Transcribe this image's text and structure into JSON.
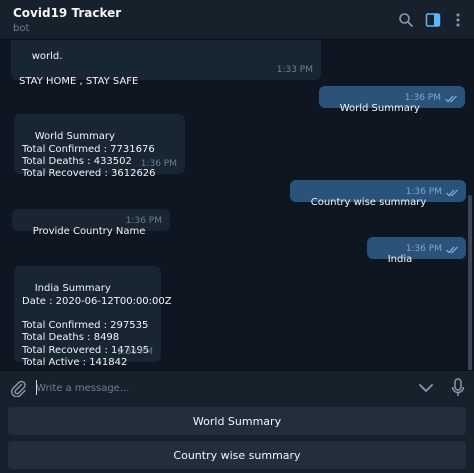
{
  "header": {
    "title": "Covid19 Tracker",
    "subtitle": "bot"
  },
  "messages": [
    {
      "direction": "in",
      "text": "world.\n\nSTAY HOME , STAY SAFE",
      "time": "1:33 PM"
    },
    {
      "direction": "out",
      "text": "World Summary",
      "time": "1:36 PM",
      "read": true
    },
    {
      "direction": "in",
      "text": "World Summary\nTotal Confirmed : 7731676\nTotal Deaths : 433502\nTotal Recovered : 3612626",
      "time": "1:36 PM"
    },
    {
      "direction": "out",
      "text": "Country wise summary",
      "time": "1:36 PM",
      "read": true
    },
    {
      "direction": "in",
      "text": "Provide Country Name",
      "time": "1:36 PM"
    },
    {
      "direction": "out",
      "text": "India",
      "time": "1:36 PM",
      "read": true
    },
    {
      "direction": "in",
      "text": "India Summary\nDate : 2020-06-12T00:00:00Z\n\nTotal Confirmed : 297535\nTotal Deaths : 8498\nTotal Recovered : 147195\nTotal Active : 141842",
      "time": "1:36 PM"
    }
  ],
  "composer": {
    "placeholder": "Write a message..."
  },
  "keyboard": {
    "buttons": [
      "World Summary",
      "Country wise summary"
    ]
  },
  "colors": {
    "background": "#0e1621",
    "panel": "#17212b",
    "incoming": "#182533",
    "outgoing": "#2b5278",
    "accent": "#5eb5f7"
  },
  "icons": {
    "header": [
      "search-icon",
      "sidebar-toggle-icon",
      "more-menu-icon"
    ],
    "composer": [
      "attach-icon",
      "chevron-down-icon",
      "microphone-icon"
    ],
    "status": "double-check-icon"
  }
}
